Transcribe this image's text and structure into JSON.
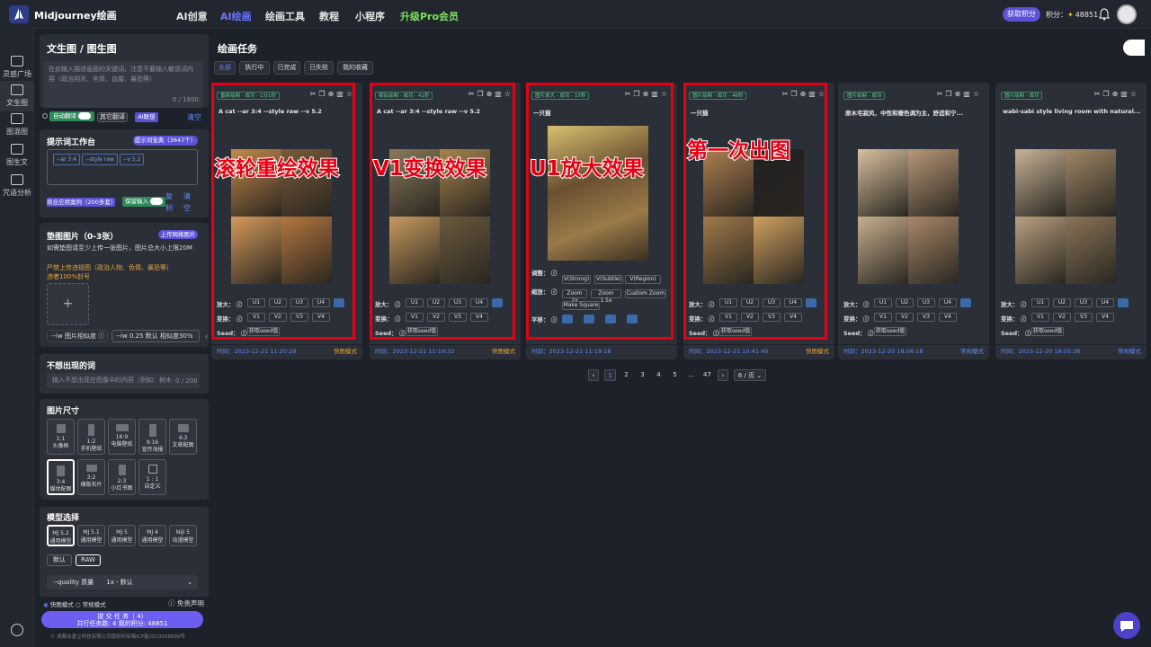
{
  "header": {
    "brand": "Midjourney绘画",
    "nav": [
      "AI创意",
      "AI绘画",
      "绘画工具",
      "教程",
      "小程序",
      "升级Pro会员"
    ],
    "get_points": "获取积分",
    "points_label": "积分",
    "points_value": "48851"
  },
  "left_nav": [
    "灵感广场",
    "文生图",
    "图混图",
    "图生文",
    "咒语分析"
  ],
  "form": {
    "title": "文生图 / 图生图",
    "prompt_placeholder": "在此输入描述画面的关键词，注意不要输入敏感词内容（政治相关、色情、血腥、暴恐等）",
    "prompt_count": "0 / 1800",
    "auto_translate": "自动翻译",
    "other_translate": "其它翻译",
    "ai_assoc": "AI联想",
    "clear": "清空",
    "workbench_title": "提示词工作台",
    "workbench_dict": "提示词宝典（3647个）",
    "workbench_tags": [
      "--ar 3:4",
      "--style raw",
      "--v 5.2"
    ],
    "commercial_cases": "商业应用案例（200多套）",
    "keep_input": "保留输入",
    "copy": "复制",
    "empty": "清空",
    "pad_title": "垫图图片（0-3张）",
    "pad_upload_btn": "上传网络图片",
    "pad_note1": "如需垫图请至少上传一张图片，图片总大小上限20M",
    "pad_note2": "严禁上传违规图（政治人物、色情、暴恐等）",
    "pad_note3": "违者100%封号",
    "iw_label": "--iw 图片相似度",
    "iw_value": "--iw 0.25 默认 相似度30%",
    "neg_title": "不想出现的词",
    "neg_placeholder": "输入不想出现在图像中的内容（例如：树木",
    "neg_count": "0 / 200",
    "size_title": "图片尺寸",
    "sizes": [
      {
        "ratio": "1:1",
        "name": "头像框"
      },
      {
        "ratio": "1:2",
        "name": "手机壁纸"
      },
      {
        "ratio": "16:9",
        "name": "电脑壁纸"
      },
      {
        "ratio": "9:16",
        "name": "宣传海报"
      },
      {
        "ratio": "4:3",
        "name": "文章配图"
      },
      {
        "ratio": "3:4",
        "name": "媒体配图"
      },
      {
        "ratio": "3:2",
        "name": "横版名片"
      },
      {
        "ratio": "2:3",
        "name": "小红书图"
      },
      {
        "ratio": "1 : 1",
        "name": "自定义"
      }
    ],
    "model_title": "模型选择",
    "models": [
      {
        "v": "MJ 5.2",
        "d": "通用模型"
      },
      {
        "v": "MJ 5.1",
        "d": "通用模型"
      },
      {
        "v": "MJ 5",
        "d": "通用模型"
      },
      {
        "v": "MJ 4",
        "d": "通用模型"
      },
      {
        "v": "Niji 5",
        "d": "动漫模型"
      }
    ],
    "style_default": "默认",
    "style_raw": "RAW",
    "quality_label": "--quality 质量",
    "quality_value": "1x - 默认",
    "fast_mode": "快图模式",
    "normal_mode": "常规模式",
    "disclaimer": "免责声明",
    "submit": "提 交 任 务（ 4）",
    "submit_sub": "并行任务数: 4    我的积分: 48851",
    "footer": "© 成都合夏立科技有限公司版权所有蜀ICP备2023008999号"
  },
  "main": {
    "title": "绘画任务",
    "tabs": [
      "全部",
      "执行中",
      "已完成",
      "已失败",
      "我的收藏"
    ],
    "cards": [
      {
        "badge": "重新绘制 - 成功 - 1分1秒",
        "prompt": "A cat --ar 3:4 --style raw --v 5.2",
        "time": "时间：2023-12-21 11:20:29",
        "mode": "快图模式",
        "overlay": "滚轮重绘效果"
      },
      {
        "badge": "相似绘制 - 成功 - 41秒",
        "prompt": "A cat --ar 3:4 --style raw --v 5.2",
        "time": "时间：2023-12-21 11:19:32",
        "mode": "快图模式",
        "overlay": "V1变换效果"
      },
      {
        "badge": "图片放大 - 成功 - 15秒",
        "prompt": "一只猫",
        "time": "时间：2023-12-21 11:19:18",
        "mode": "",
        "overlay": "U1放大效果"
      },
      {
        "badge": "图片绘制 - 成功 - 46秒",
        "prompt": "一只猫",
        "time": "时间：2023-12-21 10:41:40",
        "mode": "快图模式",
        "overlay": "第一次出图"
      },
      {
        "badge": "图片绘制 - 成功",
        "prompt": "原木宅寂风，中性和暖色调为主，舒适和宁...",
        "time": "时间：2023-12-20 18:06:18",
        "mode": "常规模式",
        "overlay": ""
      },
      {
        "badge": "图片绘制 - 成功",
        "prompt": "wabi-sabi style living room with natural...",
        "time": "时间：2023-12-20 18:05:36",
        "mode": "常规模式",
        "overlay": ""
      }
    ],
    "row_labels": {
      "zoom": "放大：",
      "vary": "变换：",
      "seed": "Seed："
    },
    "u_buttons": [
      "U1",
      "U2",
      "U3",
      "U4"
    ],
    "v_buttons": [
      "V1",
      "V2",
      "V3",
      "V4"
    ],
    "get_seed": "获取seed值",
    "upscale_rows": {
      "adjust": "调整：",
      "zoom": "缩放：",
      "move": "平移："
    },
    "upscale_buttons": [
      "V(Strong)",
      "V(Subtle)",
      "V(Region)",
      "Zoom 2x",
      "Zoom 1.5x",
      "Custom Zoom",
      "Make Square"
    ],
    "pages": [
      "1",
      "2",
      "3",
      "4",
      "5",
      "...",
      "47"
    ],
    "per_page": "6 / 页"
  }
}
